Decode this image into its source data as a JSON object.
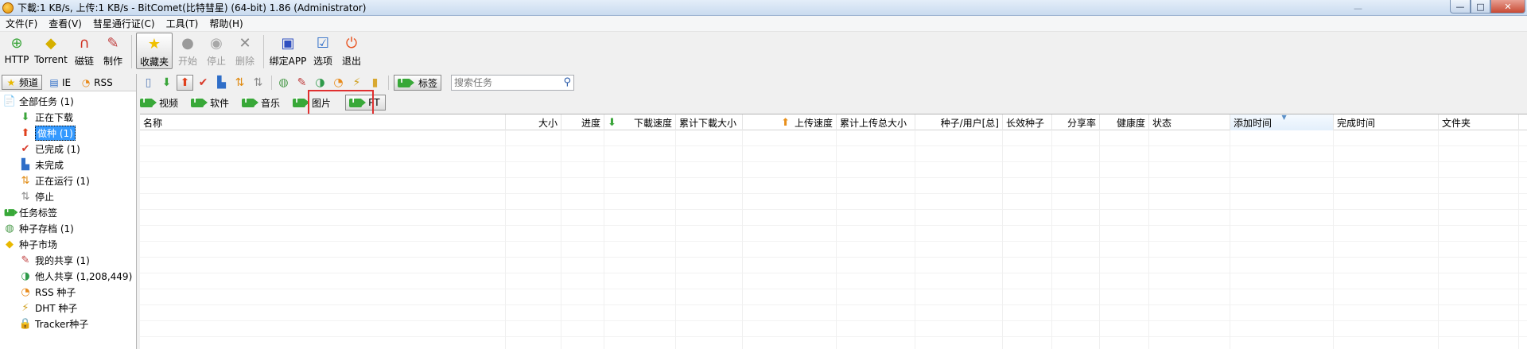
{
  "window": {
    "title": "下載:1 KB/s, 上传:1 KB/s - BitComet(比特彗星) (64-bit) 1.86 (Administrator)",
    "controls": {
      "minimize": "—",
      "maximize": "□",
      "close": "✕"
    },
    "ghost_minimize": "—"
  },
  "menu": [
    "文件(F)",
    "查看(V)",
    "彗星通行证(C)",
    "工具(T)",
    "帮助(H)"
  ],
  "toolbar": {
    "http": "HTTP",
    "torrent": "Torrent",
    "magnet": "磁链",
    "make": "制作",
    "favorites": "收藏夹",
    "start": "开始",
    "stop": "停止",
    "delete": "删除",
    "bind_app": "绑定APP",
    "options": "选项",
    "exit": "退出"
  },
  "left_tabs": {
    "channel": "频道",
    "ie": "IE",
    "rss": "RSS"
  },
  "tree": [
    {
      "label": "全部任务 (1)",
      "level": 0,
      "icon": "all-tasks-icon",
      "glyph": "📄",
      "color": "#5b7fb8"
    },
    {
      "label": "正在下载",
      "level": 1,
      "icon": "down-arrow-icon",
      "glyph": "⬇",
      "color": "#3aa53a"
    },
    {
      "label": "做种 (1)",
      "level": 1,
      "icon": "up-arrow-icon",
      "glyph": "⬆",
      "color": "#e0401c",
      "selected": true
    },
    {
      "label": "已完成 (1)",
      "level": 1,
      "icon": "check-icon",
      "glyph": "✔",
      "color": "#d93a2a"
    },
    {
      "label": "未完成",
      "level": 1,
      "icon": "incomplete-icon",
      "glyph": "▙",
      "color": "#2f6ec8"
    },
    {
      "label": "正在运行 (1)",
      "level": 1,
      "icon": "running-icon",
      "glyph": "⇅",
      "color": "#e08a10"
    },
    {
      "label": "停止",
      "level": 1,
      "icon": "stopped-icon",
      "glyph": "⇅",
      "color": "#8a8a8a"
    },
    {
      "label": "任务标签",
      "level": 0,
      "icon": "tag-icon",
      "glyph": "tag",
      "color": "#38a838"
    },
    {
      "label": "种子存档 (1)",
      "level": 0,
      "icon": "archive-icon",
      "glyph": "◍",
      "color": "#4a9a4a"
    },
    {
      "label": "种子市场",
      "level": 0,
      "icon": "market-icon",
      "glyph": "◆",
      "color": "#e8b800"
    },
    {
      "label": "我的共享 (1)",
      "level": 1,
      "icon": "my-share-icon",
      "glyph": "✎",
      "color": "#c04040"
    },
    {
      "label": "他人共享 (1,208,449)",
      "level": 1,
      "icon": "others-share-icon",
      "glyph": "◑",
      "color": "#2f9a4a"
    },
    {
      "label": "RSS 种子",
      "level": 1,
      "icon": "rss-icon",
      "glyph": "◔",
      "color": "#e88a1a"
    },
    {
      "label": "DHT 种子",
      "level": 1,
      "icon": "dht-icon",
      "glyph": "⚡",
      "color": "#d0a020"
    },
    {
      "label": "Tracker种子",
      "level": 1,
      "icon": "tracker-icon",
      "glyph": "🔒",
      "color": "#d8a830"
    }
  ],
  "task_toolbar": {
    "tag_button": "标签",
    "search_placeholder": "搜索任务"
  },
  "categories": [
    "视频",
    "软件",
    "音乐",
    "图片",
    "PT"
  ],
  "columns": [
    "名称",
    "大小",
    "进度",
    "下載速度",
    "累计下載大小",
    "上传速度",
    "累计上传总大小",
    "种子/用户[总]",
    "长效种子",
    "分享率",
    "健康度",
    "状态",
    "添加时间",
    "完成时间",
    "文件夹"
  ],
  "colors": {
    "selection": "#3399ff",
    "highlight_box": "#e03030",
    "tag_green": "#38a838"
  }
}
